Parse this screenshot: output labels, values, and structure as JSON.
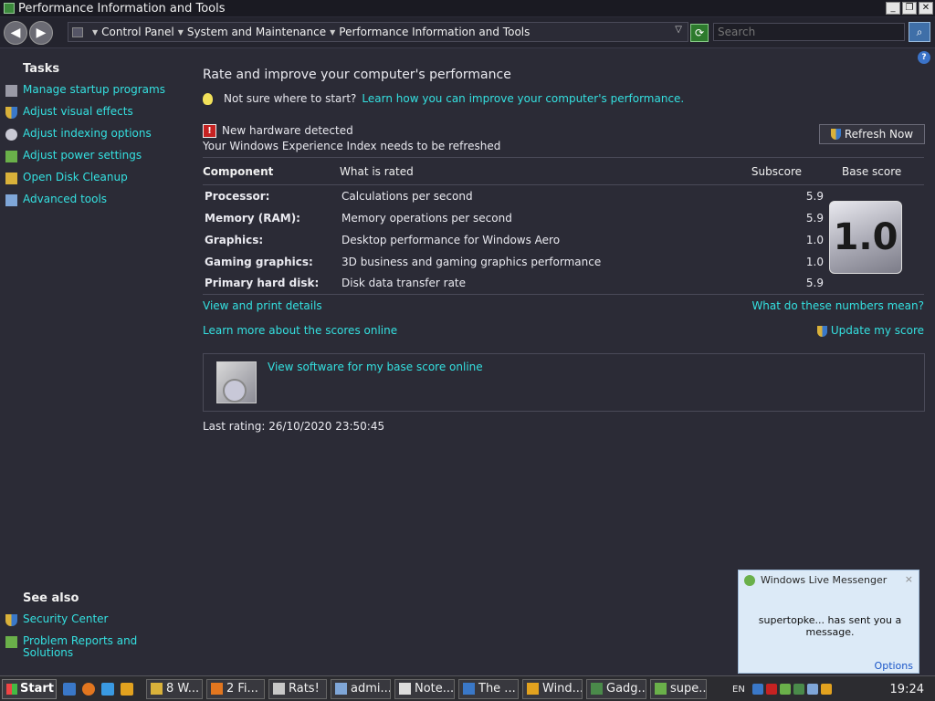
{
  "window": {
    "title": "Performance Information and Tools"
  },
  "address": {
    "crumbs": [
      "Control Panel",
      "System and Maintenance",
      "Performance Information and Tools"
    ],
    "search_placeholder": "Search"
  },
  "tasks": {
    "heading": "Tasks",
    "items": [
      {
        "label": "Manage startup programs",
        "icon": "startup-programs-icon"
      },
      {
        "label": "Adjust visual effects",
        "icon": "shield-icon"
      },
      {
        "label": "Adjust indexing options",
        "icon": "indexing-icon"
      },
      {
        "label": "Adjust power settings",
        "icon": "power-icon"
      },
      {
        "label": "Open Disk Cleanup",
        "icon": "disk-cleanup-icon"
      },
      {
        "label": "Advanced tools",
        "icon": "advanced-tools-icon"
      }
    ]
  },
  "see_also": {
    "heading": "See also",
    "items": [
      {
        "label": "Security Center",
        "icon": "security-center-icon"
      },
      {
        "label": "Problem Reports and Solutions",
        "icon": "problem-reports-icon"
      }
    ]
  },
  "main": {
    "header": "Rate and improve your computer's performance",
    "tip_text": "Not sure where to start?",
    "tip_link": "Learn how you can improve your computer's performance.",
    "alert_title": "New hardware detected",
    "alert_text": "Your Windows Experience Index needs to be refreshed",
    "refresh_button": "Refresh Now",
    "table": {
      "headers": {
        "component": "Component",
        "rated": "What is rated",
        "subscore": "Subscore",
        "base": "Base score"
      },
      "rows": [
        {
          "component": "Processor:",
          "rated": "Calculations per second",
          "subscore": "5.9"
        },
        {
          "component": "Memory (RAM):",
          "rated": "Memory operations per second",
          "subscore": "5.9"
        },
        {
          "component": "Graphics:",
          "rated": "Desktop performance for Windows Aero",
          "subscore": "1.0"
        },
        {
          "component": "Gaming graphics:",
          "rated": "3D business and gaming graphics performance",
          "subscore": "1.0"
        },
        {
          "component": "Primary hard disk:",
          "rated": "Disk data transfer rate",
          "subscore": "5.9"
        }
      ],
      "base_score": "1.0"
    },
    "links": {
      "view_print": "View and print details",
      "what_numbers": "What do these numbers mean?",
      "learn_more": "Learn more about the scores online",
      "update_score": "Update my score",
      "view_software": "View software for my base score online"
    },
    "last_rating": "Last rating: 26/10/2020 23:50:45"
  },
  "popup": {
    "title": "Windows Live Messenger",
    "message": "supertopke... has sent you a message.",
    "options": "Options",
    "close": "×"
  },
  "taskbar": {
    "start": "Start",
    "buttons": [
      {
        "label": "8 W...",
        "color": "#d9b13a"
      },
      {
        "label": "2 Fi...",
        "color": "#e2761f"
      },
      {
        "label": "Rats!",
        "color": "#c8c8c8"
      },
      {
        "label": "admi...",
        "color": "#7fa6d8"
      },
      {
        "label": "Note...",
        "color": "#dddddd"
      },
      {
        "label": "The ...",
        "color": "#3a78c8"
      },
      {
        "label": "Wind...",
        "color": "#e2a21f"
      },
      {
        "label": "Gadg...",
        "color": "#4a8a4a"
      },
      {
        "label": "supe...",
        "color": "#6ab04a"
      }
    ],
    "language": "EN",
    "clock": "19:24"
  },
  "colors": {
    "background": "#2b2b36",
    "link": "#34e0e0",
    "text": "#e8e8ee"
  }
}
